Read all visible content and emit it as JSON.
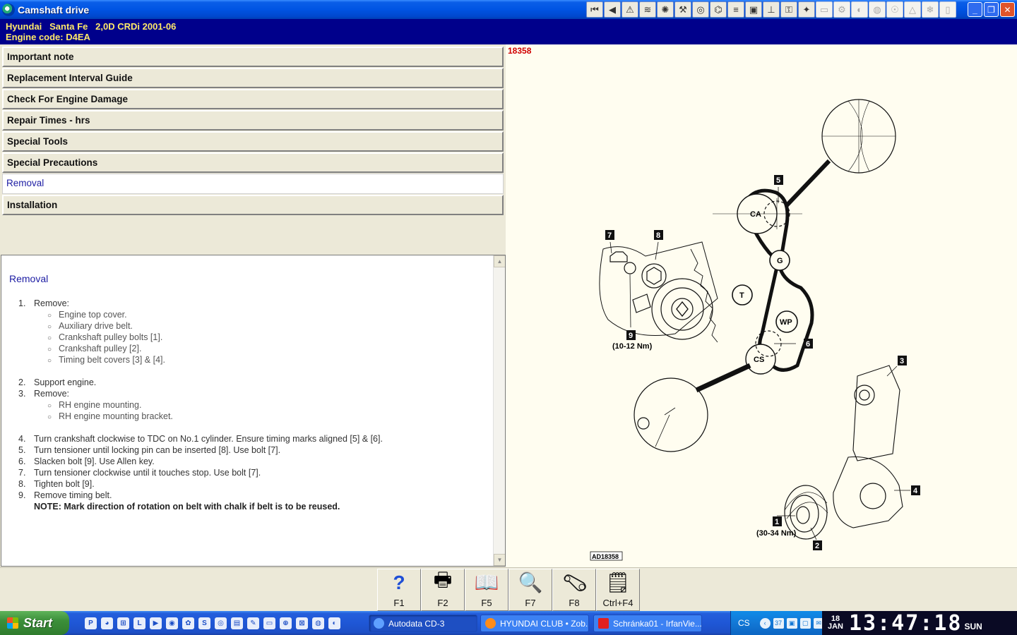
{
  "window": {
    "title": "Camshaft drive"
  },
  "vehicle": {
    "make": "Hyundai",
    "model": "Santa Fe",
    "variant": "2,0D CRDi 2001-06",
    "engine_code": "Engine code: D4EA"
  },
  "menu": [
    {
      "label": "Important note",
      "active": false
    },
    {
      "label": "Replacement Interval Guide",
      "active": false
    },
    {
      "label": "Check For Engine Damage",
      "active": false
    },
    {
      "label": "Repair Times - hrs",
      "active": false
    },
    {
      "label": "Special Tools",
      "active": false
    },
    {
      "label": "Special Precautions",
      "active": false
    },
    {
      "label": "Removal",
      "active": true
    },
    {
      "label": "Installation",
      "active": false
    }
  ],
  "content": {
    "heading": "Removal",
    "steps": [
      {
        "num": "1.",
        "text": "Remove:"
      },
      {
        "num": "2.",
        "text": "Support engine."
      },
      {
        "num": "3.",
        "text": "Remove:"
      },
      {
        "num": "4.",
        "text": "Turn crankshaft clockwise to TDC on No.1 cylinder. Ensure timing marks aligned [5] & [6]."
      },
      {
        "num": "5.",
        "text": "Turn tensioner until locking pin can be inserted [8]. Use bolt [7]."
      },
      {
        "num": "6.",
        "text": "Slacken bolt [9]. Use Allen key."
      },
      {
        "num": "7.",
        "text": "Turn tensioner clockwise until it touches stop. Use bolt [7]."
      },
      {
        "num": "8.",
        "text": "Tighten bolt [9]."
      },
      {
        "num": "9.",
        "text": "Remove timing belt."
      }
    ],
    "step1_sub": [
      "Engine top cover.",
      "Auxiliary drive belt.",
      "Crankshaft pulley bolts [1].",
      "Crankshaft pulley [2].",
      "Timing belt covers [3] & [4]."
    ],
    "step3_sub": [
      "RH engine mounting.",
      "RH engine mounting bracket."
    ],
    "note": "NOTE: Mark direction of rotation on belt with chalk if belt is to be reused."
  },
  "diagram": {
    "id": "18358",
    "ref": "AD18358",
    "labels": {
      "ca": "CA",
      "g": "G",
      "t": "T",
      "wp": "WP",
      "cs": "CS"
    },
    "callouts": [
      "1",
      "2",
      "3",
      "4",
      "5",
      "6",
      "7",
      "8",
      "9"
    ],
    "torque_9": "(10-12 Nm)",
    "torque_1": "(30-34 Nm)"
  },
  "fkeys": [
    {
      "label": "F1",
      "icon": "help-icon"
    },
    {
      "label": "F2",
      "icon": "print-icon"
    },
    {
      "label": "F5",
      "icon": "book-icon"
    },
    {
      "label": "F7",
      "icon": "magnifier-icon"
    },
    {
      "label": "F8",
      "icon": "belt-icon"
    },
    {
      "label": "Ctrl+F4",
      "icon": "notes-icon"
    }
  ],
  "taskbar": {
    "start": "Start",
    "tasks": [
      {
        "label": "Autodata CD-3",
        "active": true
      },
      {
        "label": "HYUNDAI CLUB • Zob...",
        "active": false
      },
      {
        "label": "Schránka01 - IrfanVie...",
        "active": false
      }
    ],
    "lang": "CS",
    "tray_count": "37",
    "date_day": "18",
    "date_month": "JAN",
    "time": "13:47:18",
    "weekday": "SUN"
  },
  "colors": {
    "titlebar": "#0054e3",
    "vehicle_header_bg": "#00008b",
    "vehicle_header_text": "#ffe96a",
    "diagram_bg": "#fffdf0",
    "diagram_id": "#d00000",
    "heading": "#1c1ca3"
  }
}
